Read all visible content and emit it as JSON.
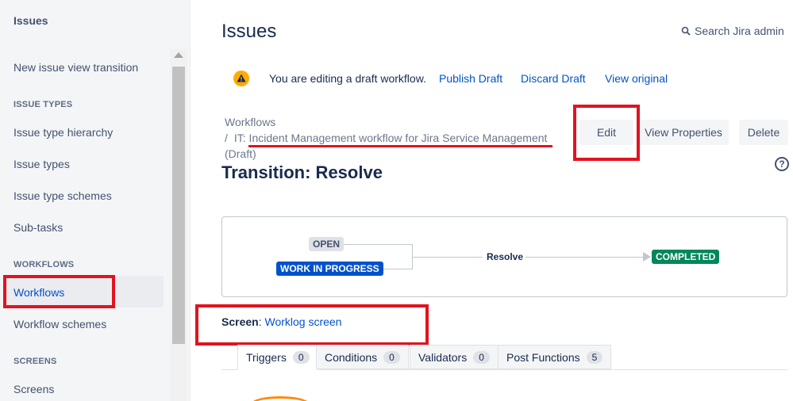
{
  "sidebar": {
    "title": "Issues",
    "items": [
      {
        "label": "New issue view transition"
      },
      {
        "section": "ISSUE TYPES"
      },
      {
        "label": "Issue type hierarchy"
      },
      {
        "label": "Issue types"
      },
      {
        "label": "Issue type schemes"
      },
      {
        "label": "Sub-tasks"
      },
      {
        "section": "WORKFLOWS"
      },
      {
        "label": "Workflows",
        "active": true
      },
      {
        "label": "Workflow schemes"
      },
      {
        "section": "SCREENS"
      },
      {
        "label": "Screens"
      }
    ]
  },
  "header": {
    "title": "Issues",
    "search_label": "Search Jira admin"
  },
  "draft_banner": {
    "message": "You are editing a draft workflow.",
    "publish": "Publish Draft",
    "discard": "Discard Draft",
    "view_original": "View original"
  },
  "breadcrumb": {
    "root": "Workflows",
    "separator": "/",
    "workflow": "IT: Incident Management workflow for Jira Service Management",
    "status": "(Draft)"
  },
  "actions": {
    "edit": "Edit",
    "view_properties": "View Properties",
    "delete": "Delete"
  },
  "transition": {
    "title": "Transition: Resolve",
    "from_statuses": [
      "OPEN",
      "WORK IN PROGRESS"
    ],
    "name": "Resolve",
    "to_status": "COMPLETED"
  },
  "screen": {
    "label": "Screen",
    "value": "Worklog screen"
  },
  "tabs": [
    {
      "label": "Triggers",
      "count": "0",
      "active": true
    },
    {
      "label": "Conditions",
      "count": "0"
    },
    {
      "label": "Validators",
      "count": "0"
    },
    {
      "label": "Post Functions",
      "count": "5"
    }
  ],
  "colors": {
    "link": "#0052cc",
    "highlight": "#e2131f",
    "wip": "#0052cc",
    "completed": "#00875a",
    "warning": "#ffab00"
  }
}
